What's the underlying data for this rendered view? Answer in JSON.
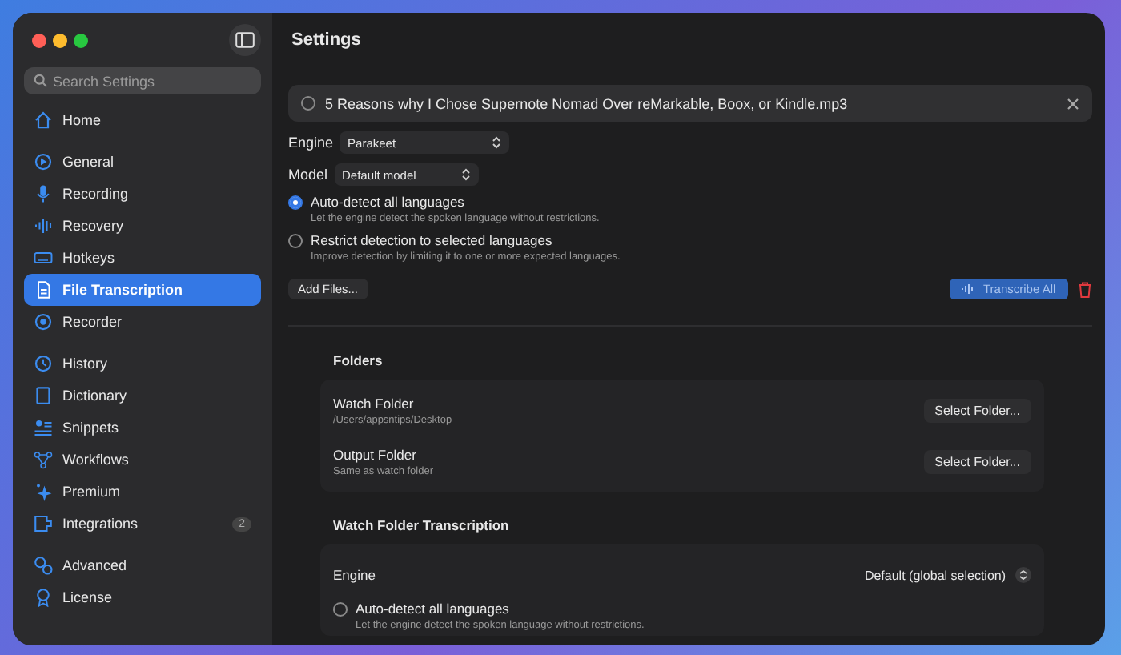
{
  "window": {
    "title": "Settings"
  },
  "sidebar": {
    "search": {
      "placeholder": "Search Settings"
    },
    "sections": [
      {
        "items": [
          {
            "label": "Home",
            "selected": false
          }
        ]
      },
      {
        "items": [
          {
            "label": "General",
            "selected": false
          },
          {
            "label": "Recording",
            "selected": false
          },
          {
            "label": "Recovery",
            "selected": false
          },
          {
            "label": "Hotkeys",
            "selected": false
          },
          {
            "label": "File Transcription",
            "selected": true
          },
          {
            "label": "Recorder",
            "selected": false
          }
        ]
      },
      {
        "items": [
          {
            "label": "History",
            "selected": false
          },
          {
            "label": "Dictionary",
            "selected": false
          },
          {
            "label": "Snippets",
            "selected": false
          },
          {
            "label": "Workflows",
            "selected": false
          },
          {
            "label": "Premium",
            "selected": false
          },
          {
            "label": "Integrations",
            "selected": false,
            "badge": "2"
          }
        ]
      },
      {
        "items": [
          {
            "label": "Advanced",
            "selected": false
          },
          {
            "label": "License",
            "selected": false
          }
        ]
      }
    ]
  },
  "file": {
    "name": "5 Reasons why I Chose Supernote Nomad Over reMarkable, Boox, or Kindle.mp3",
    "selected": false
  },
  "engine": {
    "label": "Engine",
    "value": "Parakeet"
  },
  "model": {
    "label": "Model",
    "value": "Default model"
  },
  "languages": [
    {
      "label": "Auto-detect all languages",
      "description": "Let the engine detect the spoken language without restrictions.",
      "selected": true
    },
    {
      "label": "Restrict detection to selected languages",
      "description": "Improve detection by limiting it to one or more expected languages.",
      "selected": false
    }
  ],
  "add_files": "Add Files...",
  "transcribe_all": "Transcribe All",
  "folders": {
    "title": "Folders",
    "rows": [
      {
        "label": "Watch Folder",
        "description": "/Users/appsntips/Desktop",
        "button": "Select Folder..."
      },
      {
        "label": "Output Folder",
        "description": "Same as watch folder",
        "button": "Select Folder..."
      }
    ]
  },
  "watch_transcription": {
    "title": "Watch Folder Transcription",
    "engine_label": "Engine",
    "engine_value": "Default (global selection)",
    "languages": [
      {
        "label": "Auto-detect all languages",
        "description": "Let the engine detect the spoken language without restrictions.",
        "selected": false
      }
    ]
  }
}
